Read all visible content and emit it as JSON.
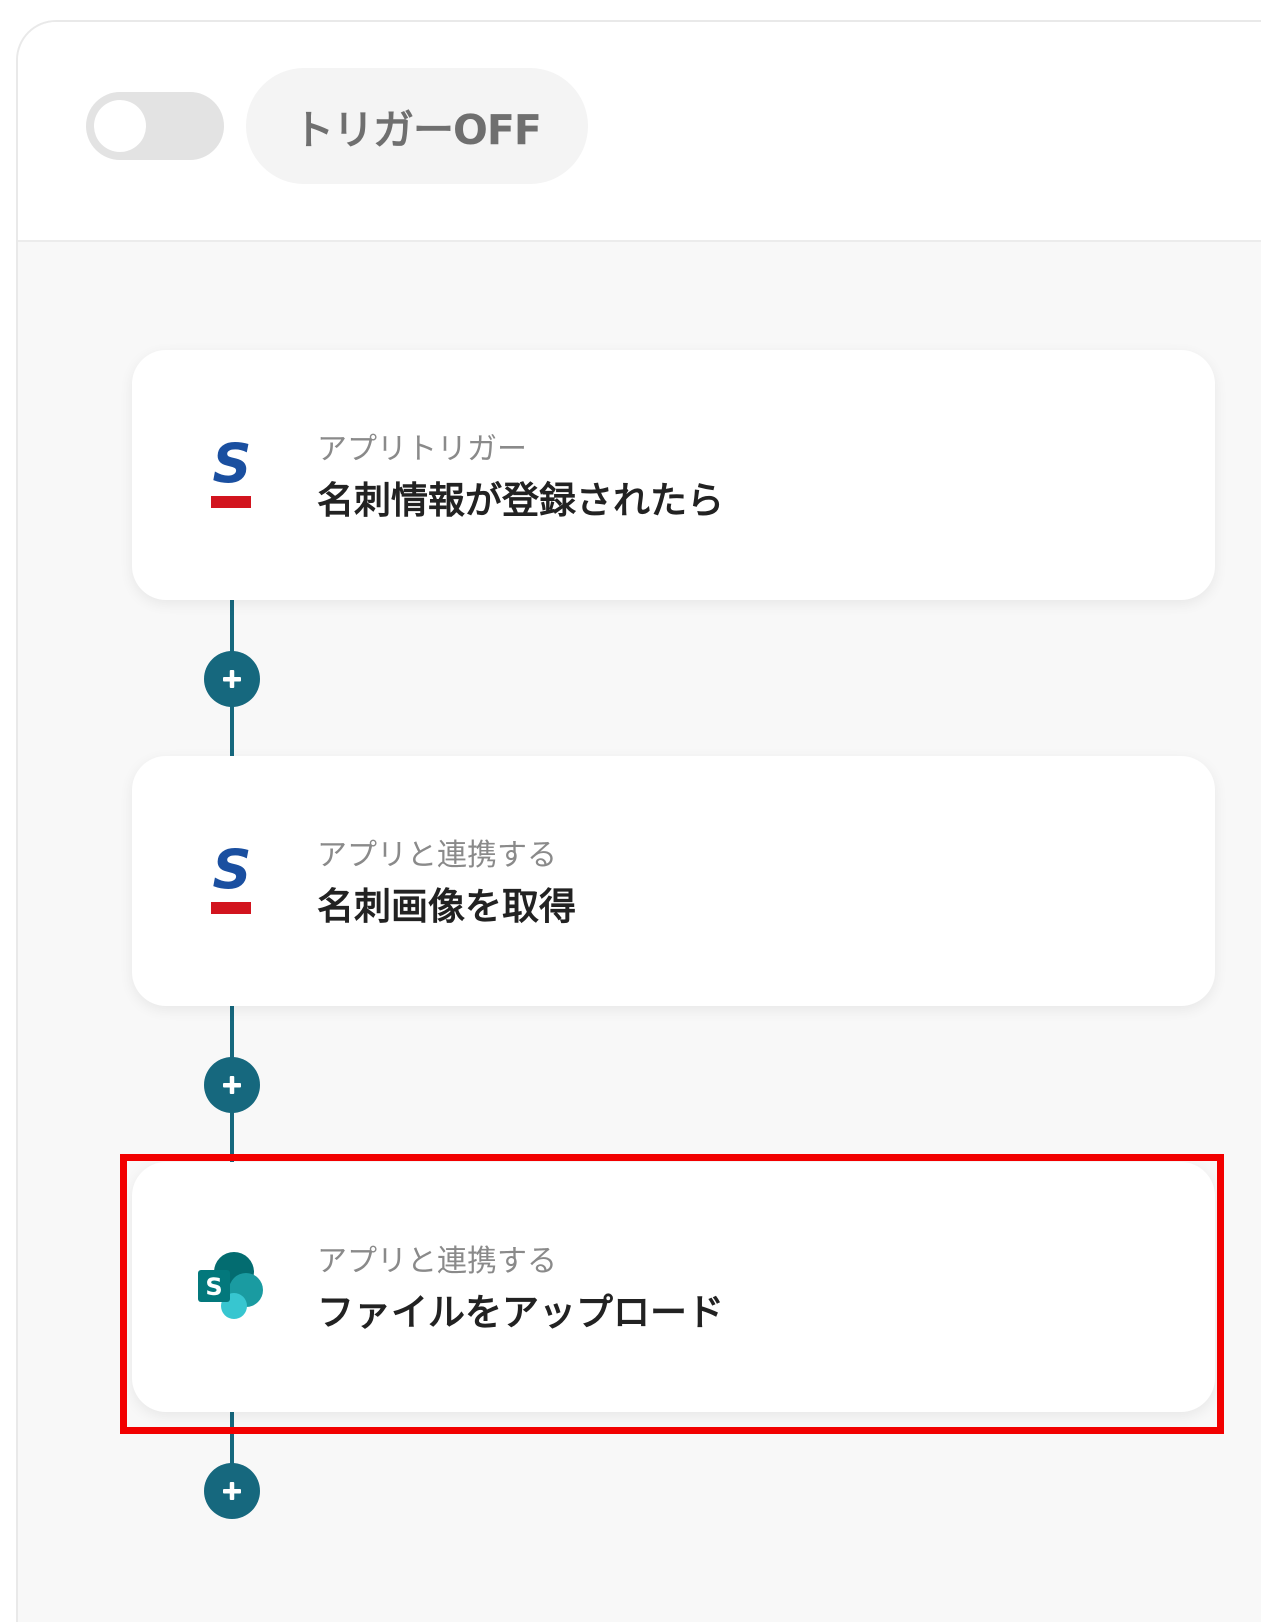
{
  "header": {
    "trigger_toggle_on": false,
    "trigger_label": "トリガーOFF"
  },
  "steps": [
    {
      "subtitle": "アプリトリガー",
      "title": "名刺情報が登録されたら",
      "icon": "sansan-logo-icon"
    },
    {
      "subtitle": "アプリと連携する",
      "title": "名刺画像を取得",
      "icon": "sansan-logo-icon"
    },
    {
      "subtitle": "アプリと連携する",
      "title": "ファイルをアップロード",
      "icon": "sharepoint-logo-icon",
      "highlighted": true
    }
  ],
  "colors": {
    "connector": "#16687e",
    "highlight": "#f20000",
    "sansan_blue": "#1a4fa0",
    "sansan_red": "#d2141e",
    "sharepoint_teal": "#038387"
  }
}
